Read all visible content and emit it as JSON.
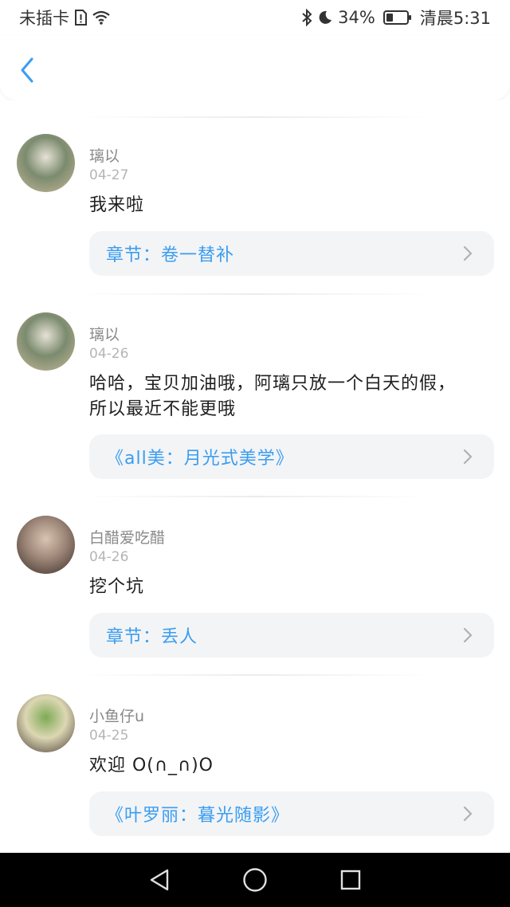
{
  "status": {
    "carrier": "未插卡",
    "battery": "34%",
    "battery_level": 0.34,
    "time": "清晨5:31"
  },
  "comments": [
    {
      "username": "璃以",
      "date": "04-27",
      "text": "我来啦",
      "link": "章节：卷一替补",
      "avatar_colors": [
        "#c9b79a",
        "#7b8b6e",
        "#e7e2d6"
      ]
    },
    {
      "username": "璃以",
      "date": "04-26",
      "text": "哈哈，宝贝加油哦，阿璃只放一个白天的假，所以最近不能更哦",
      "link": "《all美：月光式美学》",
      "avatar_colors": [
        "#c9b79a",
        "#7b8b6e",
        "#e7e2d6"
      ]
    },
    {
      "username": "白醋爱吃醋",
      "date": "04-26",
      "text": "挖个坑",
      "link": "章节：丢人",
      "avatar_colors": [
        "#3a2e27",
        "#9c8577",
        "#d8c4b2"
      ]
    },
    {
      "username": "小鱼仔u",
      "date": "04-25",
      "text": "欢迎 O(∩_∩)O",
      "link": "《叶罗丽：暮光随影》",
      "avatar_colors": [
        "#4a3b36",
        "#dcd7b3",
        "#7eaa55"
      ]
    }
  ],
  "colors": {
    "accent": "#3a9df0",
    "card_bg": "#f3f4f6"
  }
}
